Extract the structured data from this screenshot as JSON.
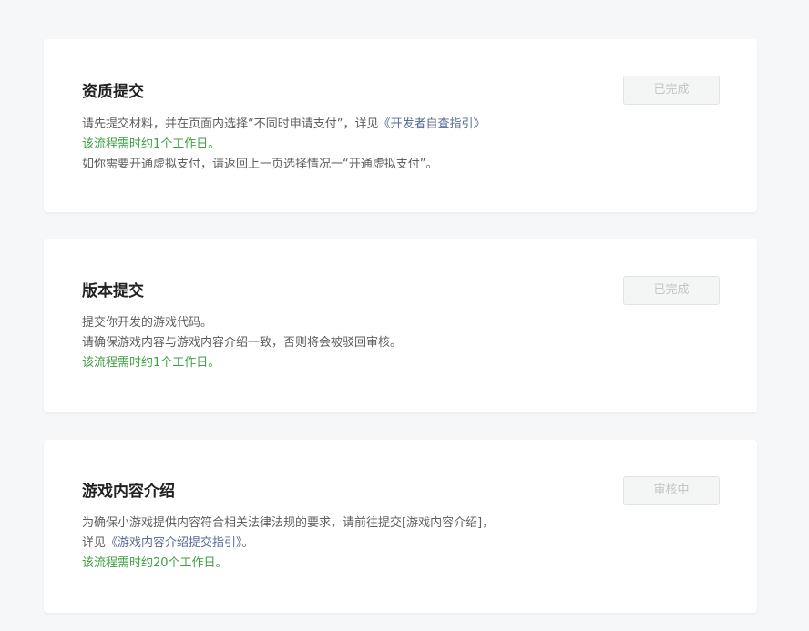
{
  "cards": [
    {
      "title": "资质提交",
      "status": "已完成",
      "line1_before": "请先提交材料，并在页面内选择“不同时申请支付”，详见",
      "line1_link": "《开发者自查指引》",
      "line2": "该流程需时约1个工作日。",
      "line3": "如你需要开通虚拟支付，请返回上一页选择情况一“开通虚拟支付”。"
    },
    {
      "title": "版本提交",
      "status": "已完成",
      "line1": "提交你开发的游戏代码。",
      "line2": "请确保游戏内容与游戏内容介绍一致，否则将会被驳回审核。",
      "line3": "该流程需时约1个工作日。"
    },
    {
      "title": "游戏内容介绍",
      "status": "审核中",
      "line1": "为确保小游戏提供内容符合相关法律法规的要求，请前往提交[游戏内容介绍]，",
      "line2_before": "详见",
      "line2_link": "《游戏内容介绍提交指引》",
      "line2_after": "。",
      "line3": "该流程需时约20个工作日。"
    }
  ],
  "colors": {
    "background": "#f6f7f9",
    "card": "#ffffff",
    "green_text": "#3f9f43",
    "link": "#576b95",
    "disabled_text": "#c5c5c5"
  }
}
